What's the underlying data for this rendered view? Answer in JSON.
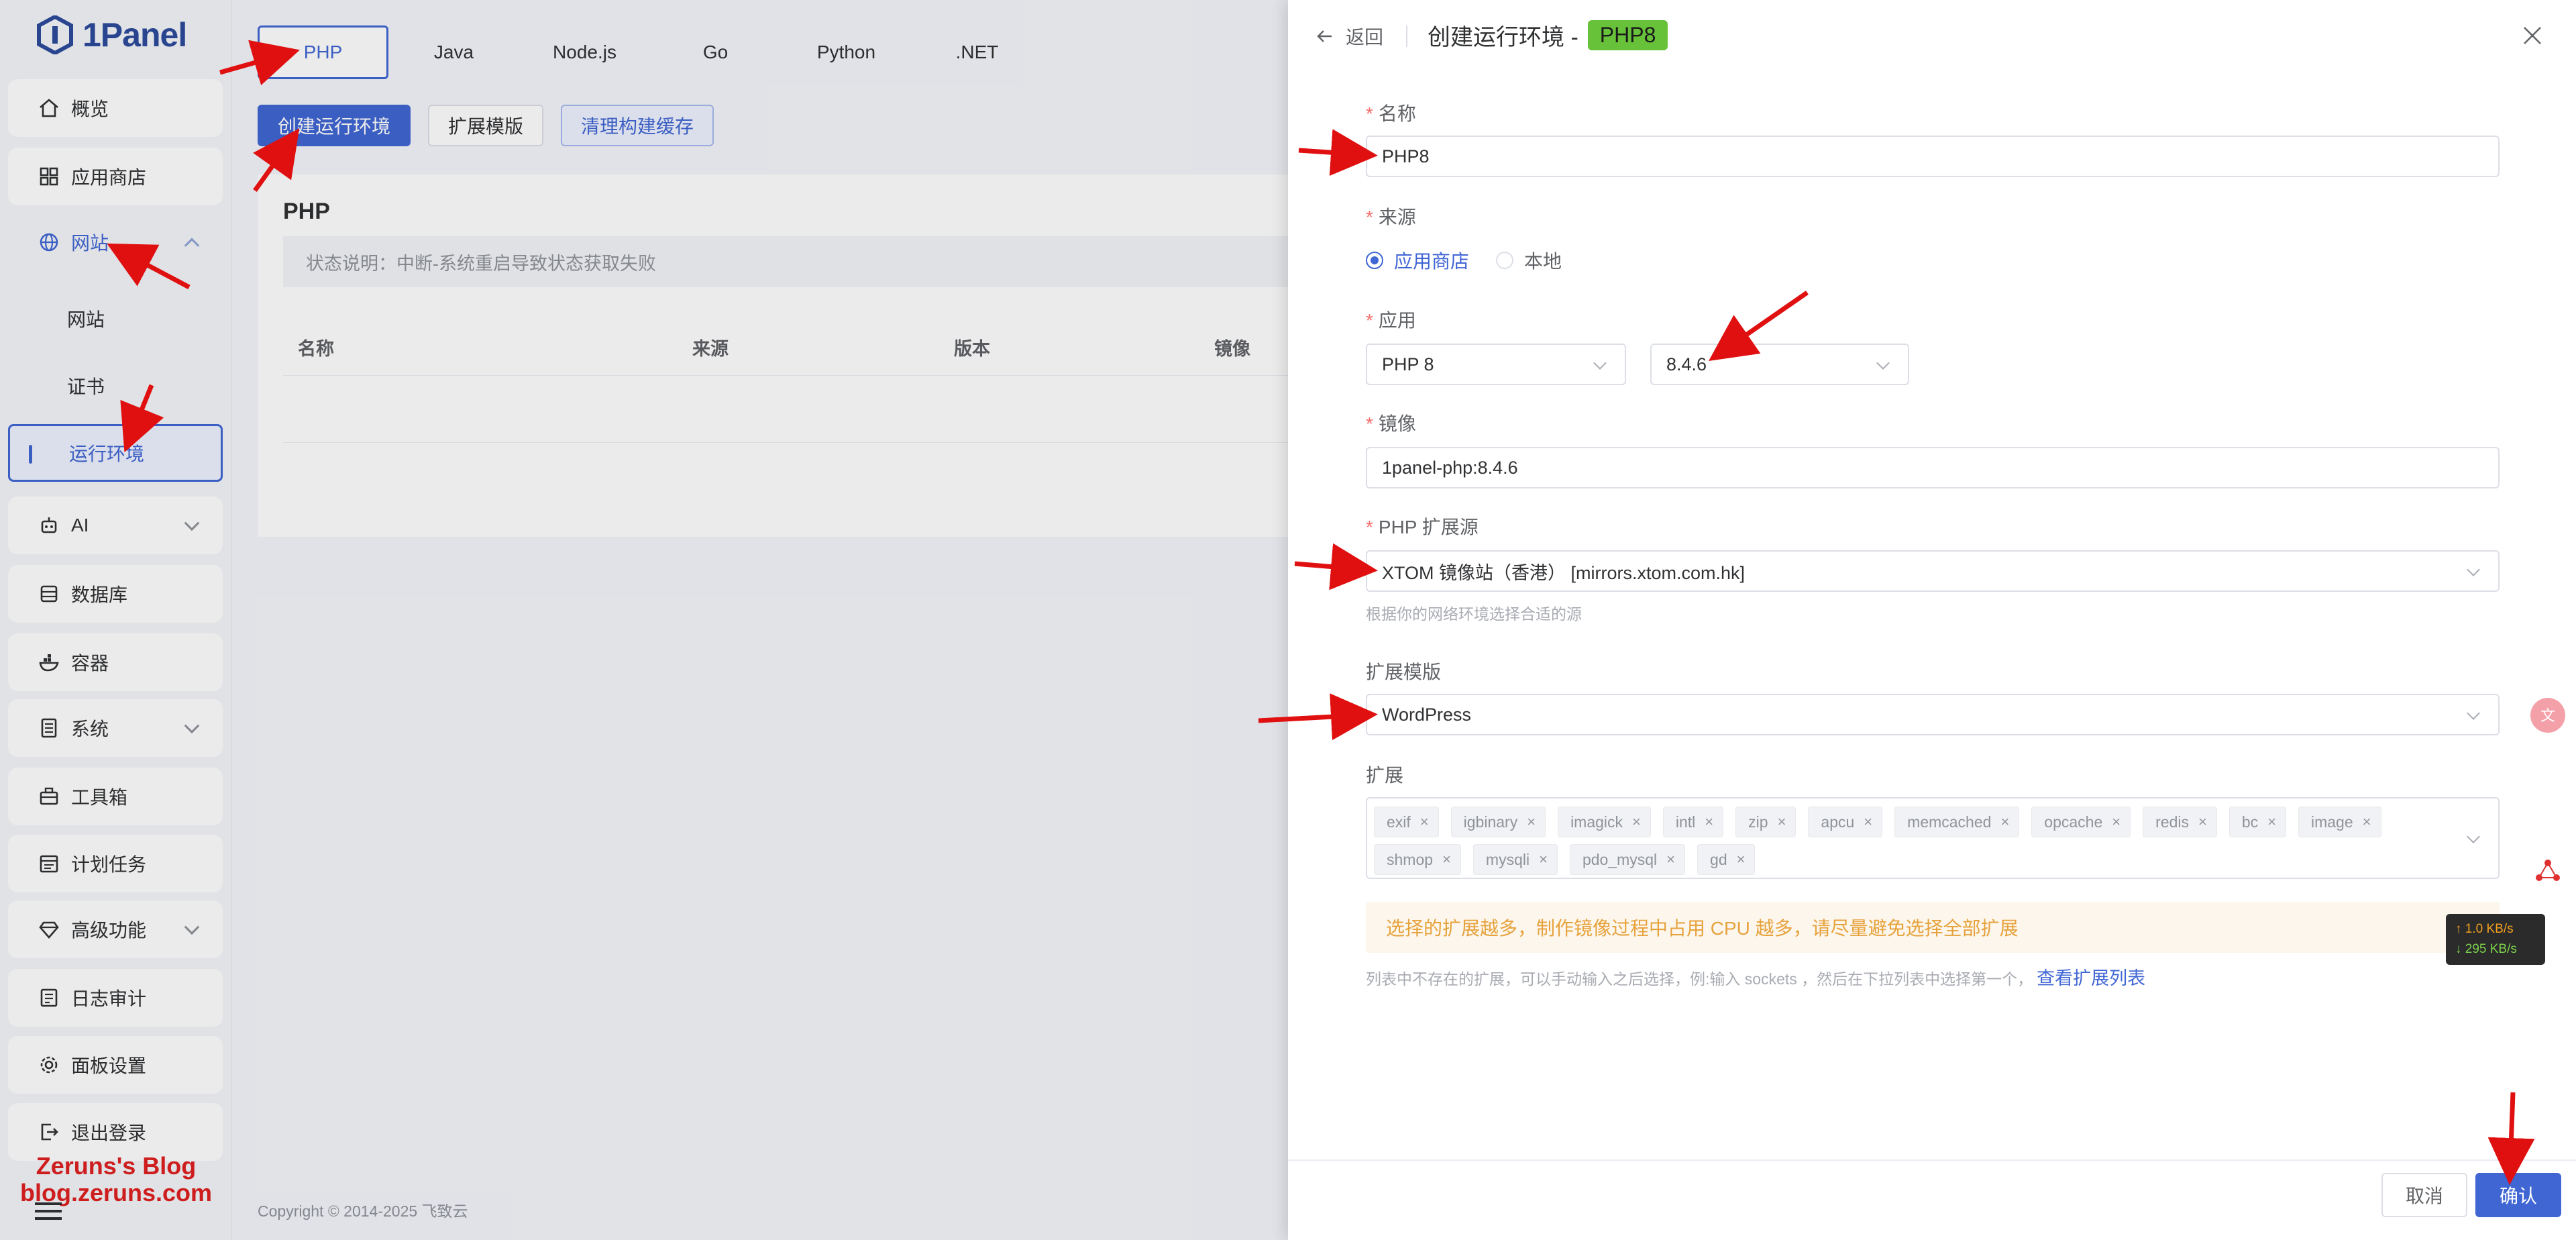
{
  "brand": {
    "name": "1Panel"
  },
  "sidebar": {
    "items": [
      {
        "label": "概览",
        "icon": "home-icon"
      },
      {
        "label": "应用商店",
        "icon": "grid-icon"
      },
      {
        "label": "网站",
        "icon": "globe-icon"
      },
      {
        "label": "网站"
      },
      {
        "label": "证书"
      },
      {
        "label": "运行环境"
      },
      {
        "label": "AI",
        "icon": "robot-icon"
      },
      {
        "label": "数据库",
        "icon": "database-icon"
      },
      {
        "label": "容器",
        "icon": "container-icon"
      },
      {
        "label": "系统",
        "icon": "server-icon"
      },
      {
        "label": "工具箱",
        "icon": "toolbox-icon"
      },
      {
        "label": "计划任务",
        "icon": "calendar-icon"
      },
      {
        "label": "高级功能",
        "icon": "diamond-icon"
      },
      {
        "label": "日志审计",
        "icon": "log-icon"
      },
      {
        "label": "面板设置",
        "icon": "gear-icon"
      },
      {
        "label": "退出登录",
        "icon": "logout-icon"
      }
    ]
  },
  "watermark": {
    "line1": "Zeruns's Blog",
    "line2": "blog.zeruns.com"
  },
  "main": {
    "tabs": [
      "PHP",
      "Java",
      "Node.js",
      "Go",
      "Python",
      ".NET"
    ],
    "toolbar": {
      "create": "创建运行环境",
      "ext_template": "扩展模版",
      "clear_cache": "清理构建缓存"
    },
    "card_title": "PHP",
    "status_note": "状态说明：中断-系统重启导致状态获取失败",
    "columns": [
      "名称",
      "来源",
      "版本",
      "镜像"
    ],
    "copyright": "Copyright © 2014-2025 飞致云"
  },
  "drawer": {
    "back": "返回",
    "title": "创建运行环境 -",
    "badge": "PHP8",
    "name": {
      "label": "名称",
      "value": "PHP8"
    },
    "source": {
      "label": "来源",
      "options": [
        "应用商店",
        "本地"
      ]
    },
    "app": {
      "label": "应用",
      "app_value": "PHP 8",
      "version_value": "8.4.6"
    },
    "image": {
      "label": "镜像",
      "value": "1panel-php:8.4.6"
    },
    "ext_source": {
      "label": "PHP 扩展源",
      "value": "XTOM 镜像站（香港）  [mirrors.xtom.com.hk]",
      "hint": "根据你的网络环境选择合适的源"
    },
    "ext_template": {
      "label": "扩展模版",
      "value": "WordPress"
    },
    "extensions": {
      "label": "扩展",
      "tags": [
        "exif",
        "igbinary",
        "imagick",
        "intl",
        "zip",
        "apcu",
        "memcached",
        "opcache",
        "redis",
        "bc",
        "image",
        "shmop",
        "mysqli",
        "pdo_mysql",
        "gd"
      ]
    },
    "warning": "选择的扩展越多，制作镜像过程中占用 CPU 越多，请尽量避免选择全部扩展",
    "ext_hint": "列表中不存在的扩展，可以手动输入之后选择，例:输入 sockets ，然后在下拉列表中选择第一个，",
    "ext_link": "查看扩展列表",
    "cancel": "取消",
    "confirm": "确认"
  },
  "net": {
    "up": "↑ 1.0 KB/s",
    "down": "↓ 295 KB/s"
  }
}
